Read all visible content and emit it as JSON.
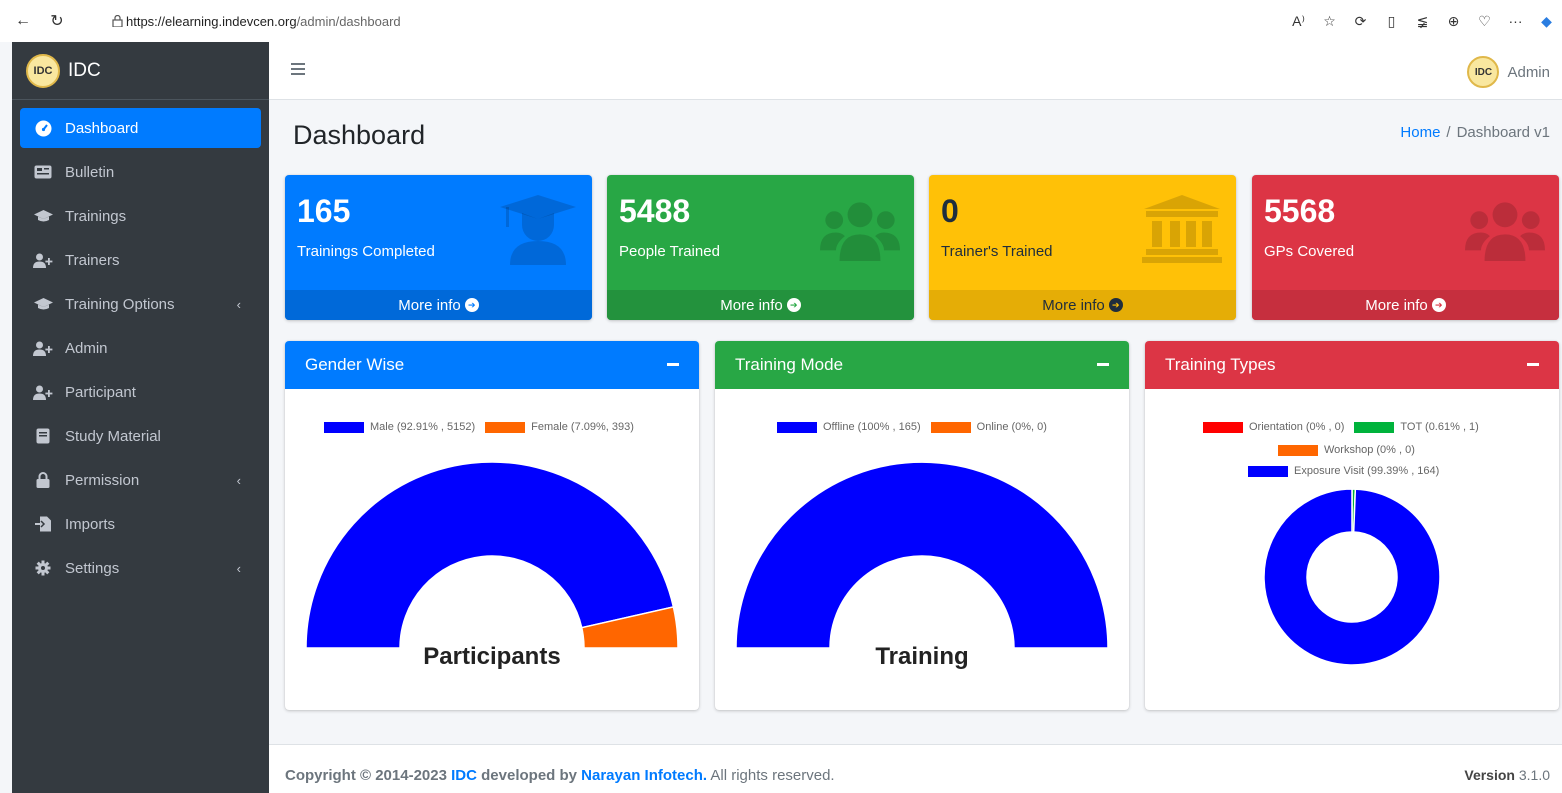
{
  "browser": {
    "url_host": "https://elearning.indevcen.org",
    "url_path": "/admin/dashboard"
  },
  "brand": {
    "logo_text": "IDC",
    "name": "IDC"
  },
  "sidebar": {
    "items": [
      {
        "label": "Dashboard",
        "icon": "tachometer-icon",
        "active": true
      },
      {
        "label": "Bulletin",
        "icon": "newspaper-icon"
      },
      {
        "label": "Trainings",
        "icon": "graduation-cap-icon"
      },
      {
        "label": "Trainers",
        "icon": "user-plus-icon"
      },
      {
        "label": "Training Options",
        "icon": "graduation-cap-icon",
        "chevron": "‹"
      },
      {
        "label": "Admin",
        "icon": "user-plus-icon"
      },
      {
        "label": "Participant",
        "icon": "user-plus-icon"
      },
      {
        "label": "Study Material",
        "icon": "book-icon"
      },
      {
        "label": "Permission",
        "icon": "lock-icon",
        "chevron": "‹"
      },
      {
        "label": "Imports",
        "icon": "file-import-icon"
      },
      {
        "label": "Settings",
        "icon": "cog-icon",
        "chevron": "‹"
      }
    ]
  },
  "topnav": {
    "user_logo_text": "IDC",
    "user_name": "Admin"
  },
  "header": {
    "title": "Dashboard",
    "breadcrumb_home": "Home",
    "breadcrumb_sep": "/",
    "breadcrumb_current": "Dashboard v1"
  },
  "stats": [
    {
      "value": "165",
      "label": "Trainings Completed",
      "more": "More info",
      "icon": "user-graduate-icon",
      "color": "#007bff"
    },
    {
      "value": "5488",
      "label": "People Trained",
      "more": "More info",
      "icon": "users-icon",
      "color": "#28a745"
    },
    {
      "value": "0",
      "label": "Trainer's Trained",
      "more": "More info",
      "icon": "landmark-icon",
      "color": "#ffc107"
    },
    {
      "value": "5568",
      "label": "GPs Covered",
      "more": "More info",
      "icon": "users-icon",
      "color": "#dc3545"
    }
  ],
  "cards": {
    "gender": {
      "title": "Gender Wise",
      "center_label": "Participants"
    },
    "mode": {
      "title": "Training Mode",
      "center_label": "Training"
    },
    "types": {
      "title": "Training Types"
    }
  },
  "chart_data": [
    {
      "type": "pie",
      "variant": "half-doughnut",
      "center_label": "Participants",
      "categories": [
        "Male (92.91% , 5152)",
        "Female (7.09%, 393)"
      ],
      "values": [
        5152,
        393
      ],
      "colors": [
        "#0000ff",
        "#ff6600"
      ]
    },
    {
      "type": "pie",
      "variant": "half-doughnut",
      "center_label": "Training",
      "categories": [
        "Offline (100% , 165)",
        "Online (0%, 0)"
      ],
      "values": [
        165,
        0
      ],
      "colors": [
        "#0000ff",
        "#ff6600"
      ]
    },
    {
      "type": "pie",
      "variant": "doughnut",
      "categories": [
        "Orientation (0% , 0)",
        "TOT (0.61% , 1)",
        "Workshop (0% , 0)",
        "Exposure Visit (99.39% , 164)"
      ],
      "values": [
        0,
        1,
        0,
        164
      ],
      "colors": [
        "#ff0000",
        "#00b33c",
        "#ff6600",
        "#0000ff"
      ]
    }
  ],
  "footer": {
    "copyright_prefix": "Copyright © 2014-2023",
    "org": "IDC",
    "developed_by": "developed by",
    "company": "Narayan Infotech.",
    "rights": "All rights reserved.",
    "version_label": "Version",
    "version_number": "3.1.0"
  }
}
